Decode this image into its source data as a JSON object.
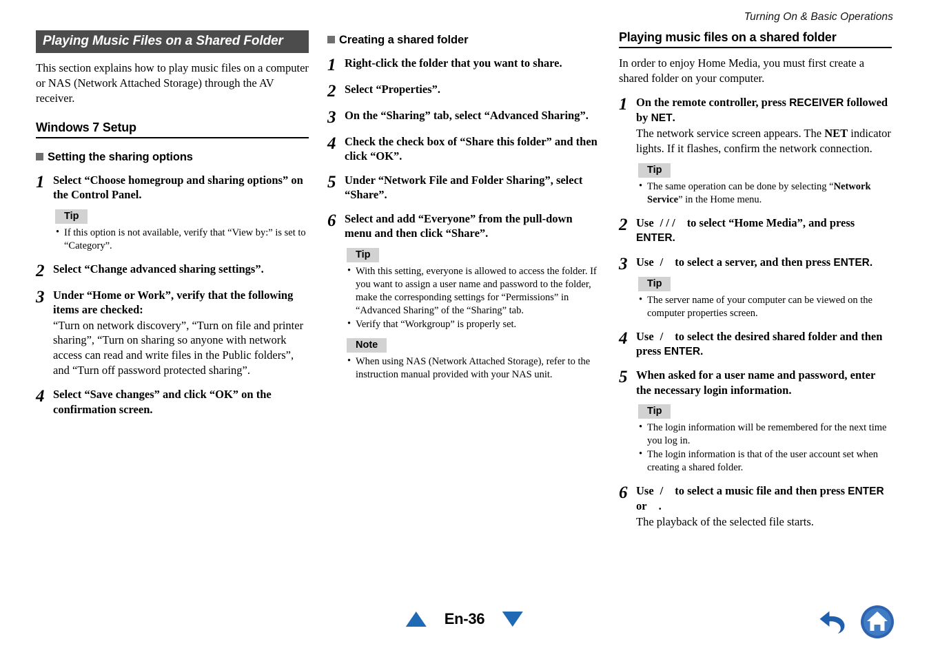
{
  "running_header": "Turning On & Basic Operations",
  "column1": {
    "banner_title": "Playing Music Files on a Shared Folder",
    "intro": "This section explains how to play music files on a computer or NAS (Network Attached Storage) through the AV receiver.",
    "section_heading": "Windows 7 Setup",
    "sub_heading": "Setting the sharing options",
    "steps": [
      {
        "num": "1",
        "title": "Select “Choose homegroup and sharing options” on the Control Panel.",
        "callout": {
          "badge": "Tip",
          "items": [
            "If this option is not available, verify that “View by:” is set to “Category”."
          ]
        }
      },
      {
        "num": "2",
        "title": "Select “Change advanced sharing settings”."
      },
      {
        "num": "3",
        "title": "Under “Home or Work”, verify that the following items are checked:",
        "desc": "“Turn on network discovery”, “Turn on file and printer sharing”, “Turn on sharing so anyone with network access can read and write files in the Public folders”, and “Turn off password protected sharing”."
      },
      {
        "num": "4",
        "title": "Select “Save changes” and click “OK” on the confirmation screen."
      }
    ]
  },
  "column2": {
    "sub_heading": "Creating a shared folder",
    "steps": [
      {
        "num": "1",
        "title": "Right-click the folder that you want to share."
      },
      {
        "num": "2",
        "title": "Select “Properties”."
      },
      {
        "num": "3",
        "title": "On the “Sharing” tab, select “Advanced Sharing”."
      },
      {
        "num": "4",
        "title": "Check the check box of “Share this folder” and then click “OK”."
      },
      {
        "num": "5",
        "title": "Under “Network File and Folder Sharing”, select “Share”."
      },
      {
        "num": "6",
        "title": "Select and add “Everyone” from the pull-down menu and then click “Share”."
      }
    ],
    "tip": {
      "badge": "Tip",
      "items": [
        "With this setting, everyone is allowed to access the folder. If you want to assign a user name and password to the folder, make the corresponding settings for “Permissions” in “Advanced Sharing” of the “Sharing” tab.",
        "Verify that “Workgroup” is properly set."
      ]
    },
    "note": {
      "badge": "Note",
      "items": [
        "When using NAS (Network Attached Storage), refer to the instruction manual provided with your NAS unit."
      ]
    }
  },
  "column3": {
    "section_heading": "Playing music files on a shared folder",
    "intro": "In order to enjoy Home Media, you must first create a shared folder on your computer.",
    "step1": {
      "num": "1",
      "title_a": "On the remote controller, press ",
      "title_key1": "RECEIVER",
      "title_b": " followed by ",
      "title_key2": "NET",
      "title_c": ".",
      "desc_a": "The network service screen appears. The ",
      "desc_key": "NET",
      "desc_b": " indicator lights. If it flashes, confirm the network connection.",
      "tip_badge": "Tip",
      "tip_item_a": "The same operation can be done by selecting “",
      "tip_item_bold": "Network Service",
      "tip_item_b": "” in the Home menu."
    },
    "step2": {
      "num": "2",
      "use": "Use",
      "slashes": "/  /  /",
      "mid": "to select “Home Media”, and press ",
      "key": "ENTER."
    },
    "step3": {
      "num": "3",
      "use": "Use",
      "slashes": "/",
      "mid": "to select a server, and then press ",
      "key": "ENTER.",
      "tip_badge": "Tip",
      "tip_items": [
        "The server name of your computer can be viewed on the computer properties screen."
      ]
    },
    "step4": {
      "num": "4",
      "use": "Use",
      "slashes": "/",
      "mid": "to select the desired shared folder and then press ",
      "key": "ENTER."
    },
    "step5": {
      "num": "5",
      "title": "When asked for a user name and password, enter the necessary login information.",
      "tip_badge": "Tip",
      "tip_items": [
        "The login information will be remembered for the next time you log in.",
        "The login information is that of the user account set when creating a shared folder."
      ]
    },
    "step6": {
      "num": "6",
      "use": "Use",
      "slashes": "/",
      "mid": "to select a music file and then press ",
      "key": "ENTER",
      "or": "or",
      "period": ".",
      "desc": "The playback of the selected file starts."
    }
  },
  "footer": {
    "page_label": "En-36",
    "prev_icon": "triangle-up-icon",
    "next_icon": "triangle-down-icon",
    "back_icon": "back-arrow-icon",
    "home_icon": "home-icon",
    "accent_blue": "#1f69b5",
    "home_blue": "#3a72bd"
  }
}
